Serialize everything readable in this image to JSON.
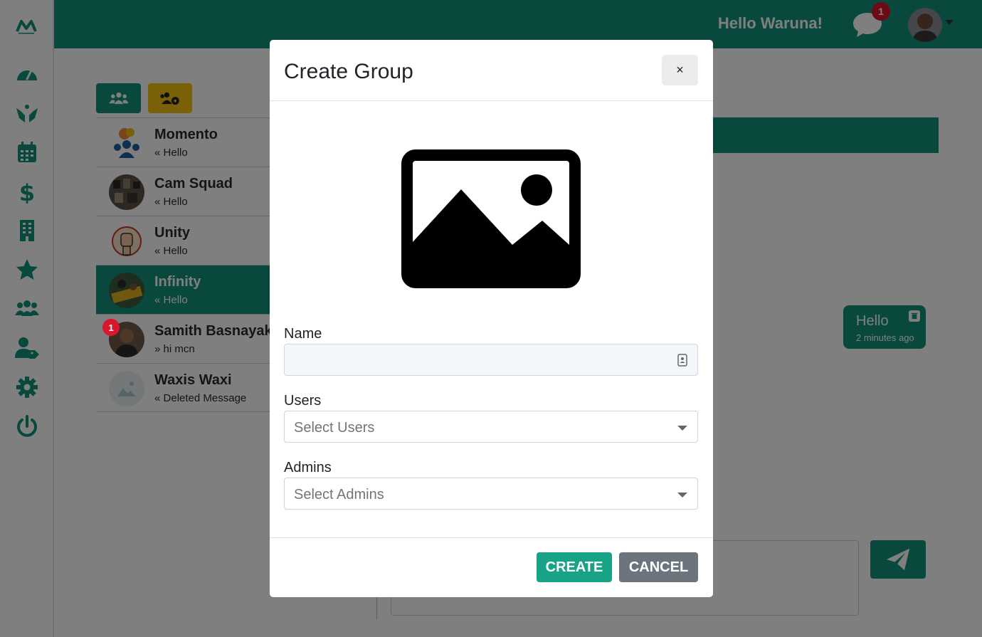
{
  "header": {
    "greeting": "Hello Waruna!",
    "notification_count": "1"
  },
  "sidebar": {
    "logo": "momento-logo-icon",
    "items": [
      {
        "icon": "dashboard-icon"
      },
      {
        "icon": "hands-icon"
      },
      {
        "icon": "calendar-icon"
      },
      {
        "icon": "dollar-icon"
      },
      {
        "icon": "building-icon"
      },
      {
        "icon": "star-icon"
      },
      {
        "icon": "users-icon"
      },
      {
        "icon": "user-tag-icon"
      },
      {
        "icon": "gear-icon"
      },
      {
        "icon": "power-icon"
      }
    ]
  },
  "chats": [
    {
      "name": "Momento",
      "message": "Hello",
      "direction": "in",
      "active": false,
      "badge": ""
    },
    {
      "name": "Cam Squad",
      "message": "Hello",
      "direction": "in",
      "active": false,
      "badge": ""
    },
    {
      "name": "Unity",
      "message": "Hello",
      "direction": "in",
      "active": false,
      "badge": ""
    },
    {
      "name": "Infinity",
      "message": "Hello",
      "direction": "in",
      "active": true,
      "badge": ""
    },
    {
      "name": "Samith Basnayaka",
      "message": "hi mcn",
      "direction": "out",
      "active": false,
      "badge": "1"
    },
    {
      "name": "Waxis Waxi",
      "message": "Deleted Message",
      "direction": "in",
      "active": false,
      "badge": ""
    }
  ],
  "message_bubble": {
    "text": "Hello",
    "time": "2 minutes ago"
  },
  "modal": {
    "title": "Create Group",
    "close_label": "×",
    "name_label": "Name",
    "name_value": "",
    "users_label": "Users",
    "users_placeholder": "Select Users",
    "admins_label": "Admins",
    "admins_placeholder": "Select Admins",
    "create_label": "CREATE",
    "cancel_label": "CANCEL"
  },
  "colors": {
    "brand": "#13917a",
    "accent_yellow": "#f5c10f",
    "badge_red": "#d9162b",
    "cancel_gray": "#6c757d"
  }
}
